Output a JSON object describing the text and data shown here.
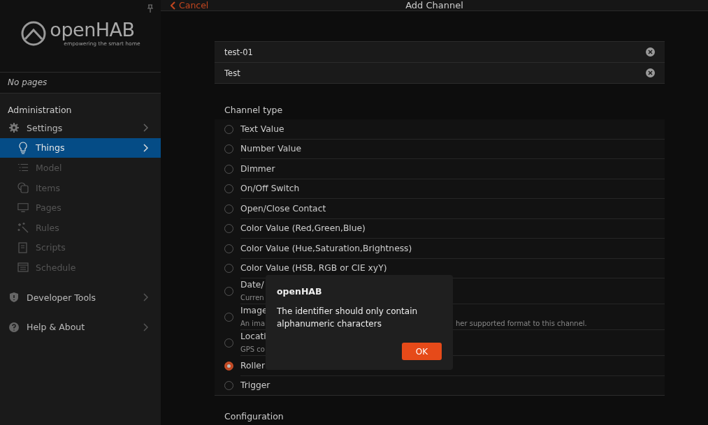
{
  "sidebar": {
    "logo_text": "openHAB",
    "logo_tagline": "empowering the smart home",
    "pages_note": "No pages",
    "section_title": "Administration",
    "items": [
      {
        "label": "Settings",
        "selected": false
      },
      {
        "label": "Things",
        "selected": true
      },
      {
        "label": "Model",
        "selected": false
      },
      {
        "label": "Items",
        "selected": false
      },
      {
        "label": "Pages",
        "selected": false
      },
      {
        "label": "Rules",
        "selected": false
      },
      {
        "label": "Scripts",
        "selected": false
      },
      {
        "label": "Schedule",
        "selected": false
      }
    ],
    "bottom_items": [
      {
        "label": "Developer Tools"
      },
      {
        "label": "Help & About"
      }
    ]
  },
  "navbar": {
    "back": "Cancel",
    "title": "Add Channel"
  },
  "fields": [
    {
      "value": "test-01"
    },
    {
      "value": "Test"
    }
  ],
  "channel_type": {
    "title": "Channel type",
    "options": [
      {
        "label": "Text Value",
        "selected": false
      },
      {
        "label": "Number Value",
        "selected": false
      },
      {
        "label": "Dimmer",
        "selected": false
      },
      {
        "label": "On/Off Switch",
        "selected": false
      },
      {
        "label": "Open/Close Contact",
        "selected": false
      },
      {
        "label": "Color Value (Red,Green,Blue)",
        "selected": false
      },
      {
        "label": "Color Value (Hue,Saturation,Brightness)",
        "selected": false
      },
      {
        "label": "Color Value (HSB, RGB or CIE xyY)",
        "selected": false
      },
      {
        "label": "Date/",
        "description": [
          "Curren"
        ],
        "selected": false
      },
      {
        "label": "Image",
        "description": [
          "An ima",
          "her supported format to this channel."
        ],
        "selected": false
      },
      {
        "label": "Locati",
        "description": [
          "GPS co"
        ],
        "selected": false
      },
      {
        "label": "Roller",
        "selected": true
      },
      {
        "label": "Trigger",
        "selected": false
      }
    ]
  },
  "next_section": "Configuration",
  "dialog": {
    "title": "openHAB",
    "message": "The identifier should only contain alphanumeric characters",
    "button": "OK"
  }
}
